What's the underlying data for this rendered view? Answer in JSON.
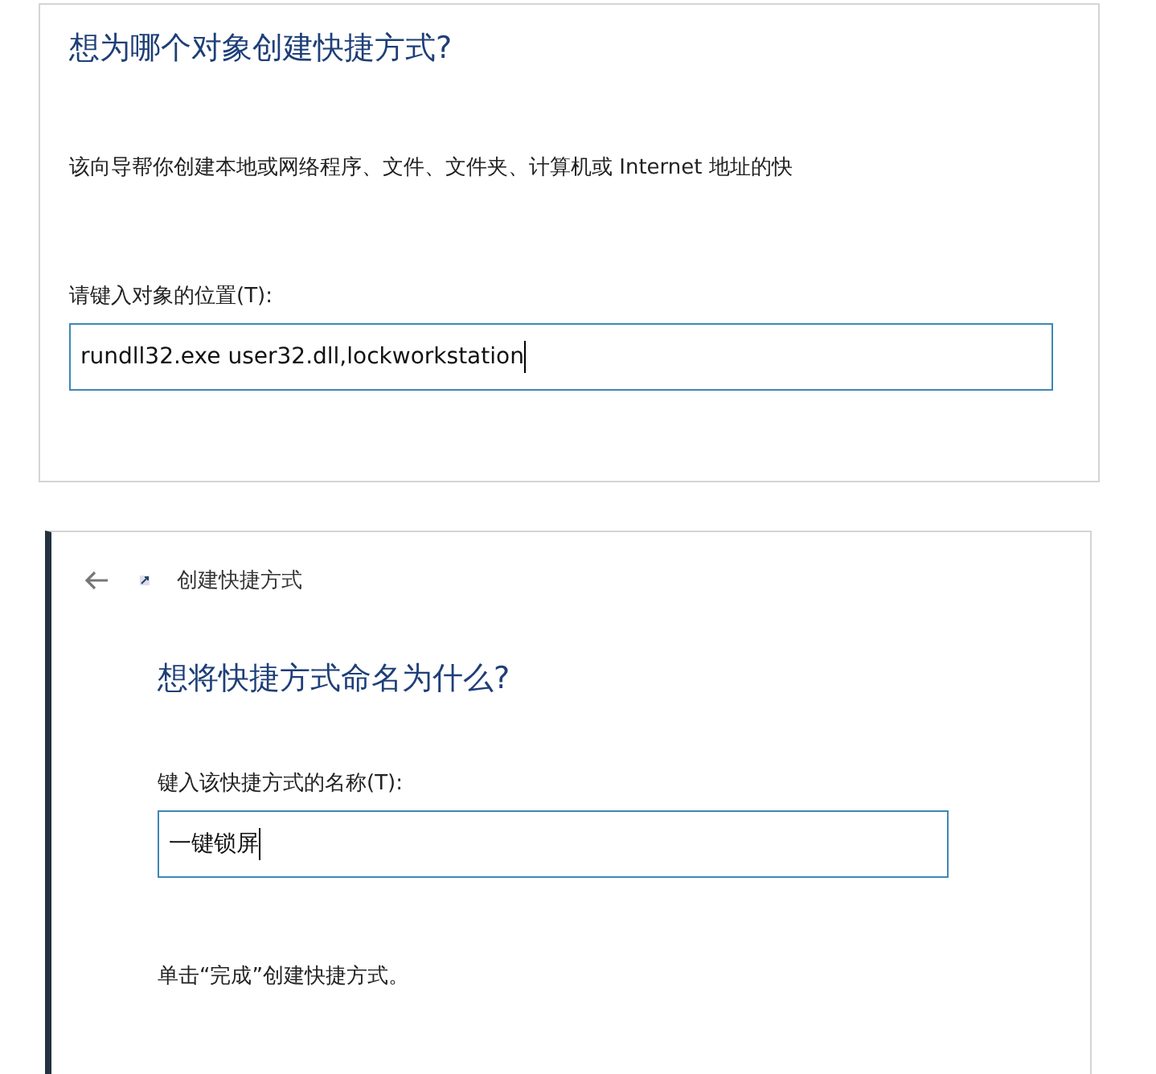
{
  "location_step": {
    "heading": "想为哪个对象创建快捷方式?",
    "description": "该向导帮你创建本地或网络程序、文件、文件夹、计算机或 Internet 地址的快",
    "field_label": "请键入对象的位置(T):",
    "field_value": "rundll32.exe user32.dll,lockworkstation"
  },
  "name_step": {
    "window_title": "创建快捷方式",
    "heading": "想将快捷方式命名为什么?",
    "field_label": "键入该快捷方式的名称(T):",
    "field_value": "一键锁屏",
    "note": "单击“完成”创建快捷方式。"
  }
}
